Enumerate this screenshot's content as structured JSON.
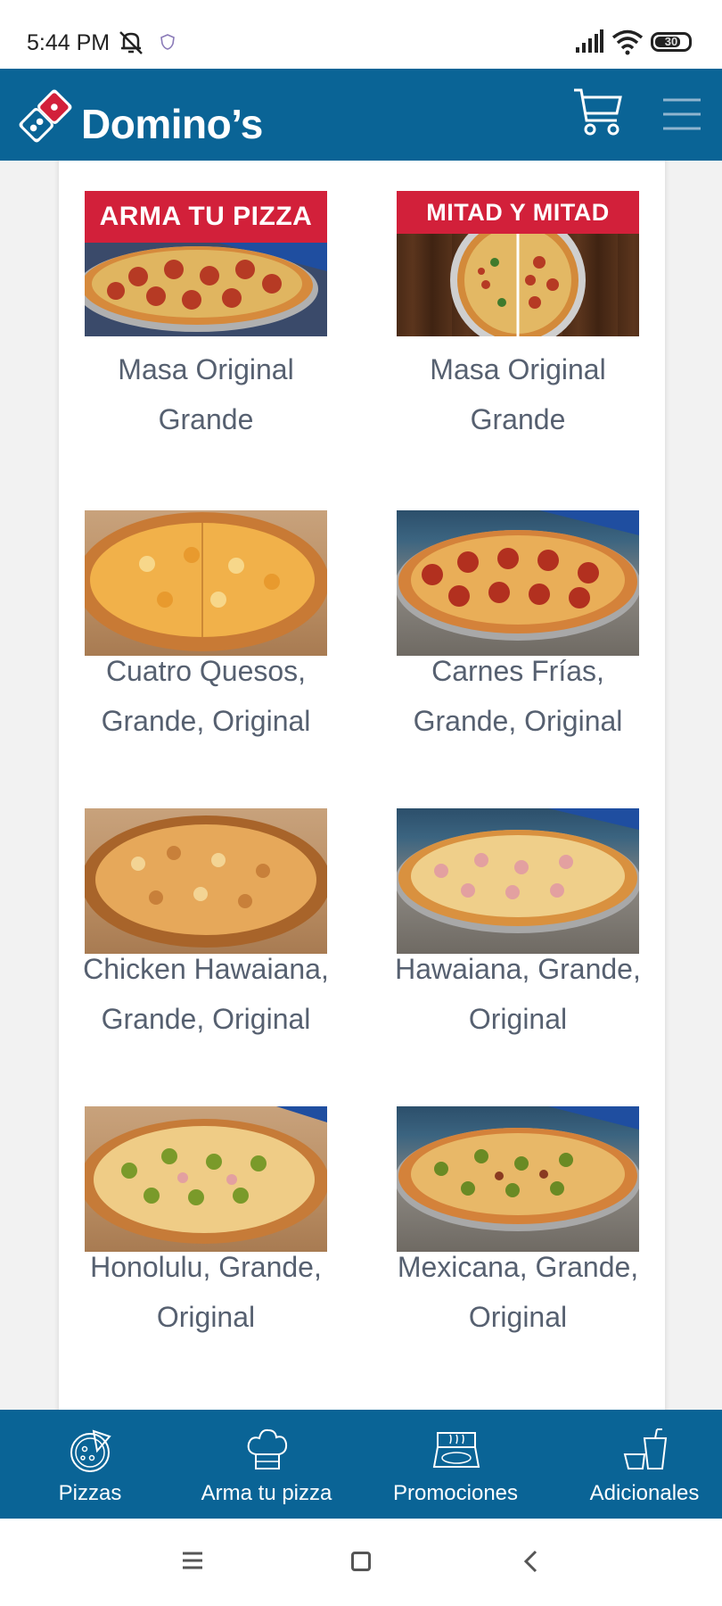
{
  "status_bar": {
    "time": "5:44 PM",
    "battery": "30",
    "icons": [
      "mute-icon",
      "shield-icon",
      "signal-icon",
      "wifi-icon",
      "battery-icon"
    ]
  },
  "header": {
    "brand": "Domino’s",
    "icons": [
      "dominos-logo-icon",
      "cart-icon",
      "hamburger-menu-icon"
    ],
    "colors": {
      "brand_blue": "#0a6496",
      "brand_red": "#d2203a"
    }
  },
  "products": [
    {
      "label": "Masa Original Grande",
      "banner": "ARMA TU PIZZA"
    },
    {
      "label": "Masa Original Grande",
      "banner": "MITAD Y MITAD"
    },
    {
      "label": "Cuatro Quesos, Grande, Original"
    },
    {
      "label": "Carnes Frías, Grande, Original"
    },
    {
      "label": "Chicken Hawaiana, Grande, Original"
    },
    {
      "label": "Hawaiana, Grande, Original"
    },
    {
      "label": "Honolulu, Grande, Original"
    },
    {
      "label": "Mexicana, Grande, Original"
    }
  ],
  "bottom_nav": [
    {
      "label": "Pizzas",
      "icon": "pizza-icon"
    },
    {
      "label": "Arma tu pizza",
      "icon": "chef-hat-icon"
    },
    {
      "label": "Promociones",
      "icon": "pizza-box-icon"
    },
    {
      "label": "Adicionales",
      "icon": "drinks-icon"
    }
  ],
  "system_nav": {
    "icons": [
      "recent-apps-icon",
      "home-icon",
      "back-icon"
    ]
  }
}
